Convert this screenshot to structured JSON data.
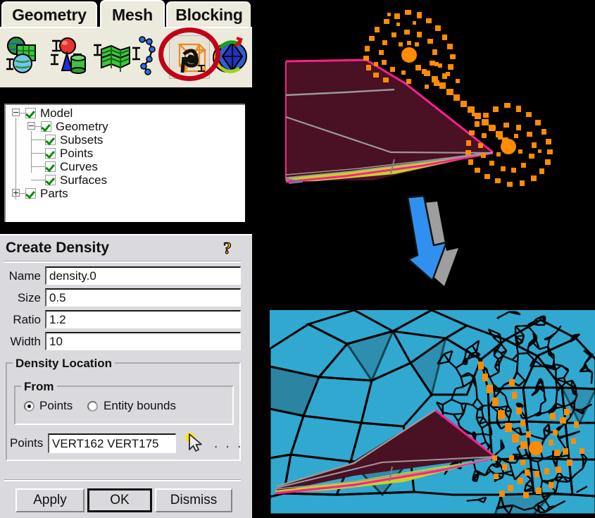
{
  "app": {
    "tabs": [
      {
        "label": "Geometry",
        "selected": false
      },
      {
        "label": "Mesh",
        "selected": true
      },
      {
        "label": "Blocking",
        "selected": false
      }
    ],
    "toolbar_icons": [
      {
        "name": "create-geometry-icon",
        "tooltip": "Create Geometry"
      },
      {
        "name": "create-body-icon",
        "tooltip": "Create Body"
      },
      {
        "name": "surface-mesh-icon",
        "tooltip": "Surface Mesh Setup"
      },
      {
        "name": "curve-mesh-icon",
        "tooltip": "Curve Mesh Setup"
      },
      {
        "name": "create-density-icon",
        "tooltip": "Create Mesh Density"
      },
      {
        "name": "compute-mesh-icon",
        "tooltip": "Compute Mesh"
      }
    ],
    "highlight_annotation": "red-circle-on-create-density-icon"
  },
  "tree": {
    "nodes": [
      {
        "label": "Model",
        "depth": 0,
        "checked": true,
        "expander": "minus"
      },
      {
        "label": "Geometry",
        "depth": 1,
        "checked": true,
        "expander": "minus"
      },
      {
        "label": "Subsets",
        "depth": 2,
        "checked": true,
        "expander": "none"
      },
      {
        "label": "Points",
        "depth": 2,
        "checked": true,
        "expander": "none"
      },
      {
        "label": "Curves",
        "depth": 2,
        "checked": true,
        "expander": "none"
      },
      {
        "label": "Surfaces",
        "depth": 2,
        "checked": true,
        "expander": "none"
      },
      {
        "label": "Parts",
        "depth": 1,
        "checked": true,
        "expander": "plus"
      }
    ]
  },
  "form": {
    "title": "Create Density",
    "help_icon": "question-mark-help-icon",
    "fields": [
      {
        "label": "Name",
        "value": "density.0"
      },
      {
        "label": "Size",
        "value": "0.5"
      },
      {
        "label": "Ratio",
        "value": "1.2"
      },
      {
        "label": "Width",
        "value": "10"
      }
    ],
    "location_group": "Density Location",
    "from_group": "From",
    "radios": [
      {
        "label": "Points",
        "selected": true
      },
      {
        "label": "Entity bounds",
        "selected": false
      }
    ],
    "points_label": "Points",
    "points_value": "VERT162 VERT175",
    "select_cursor_icon": "mouse-cursor-select-icon",
    "more_options": ". . .",
    "buttons": [
      {
        "label": "Apply",
        "default": false
      },
      {
        "label": "OK",
        "default": true
      },
      {
        "label": "Dismiss",
        "default": false
      }
    ]
  },
  "viewports": {
    "top": {
      "name": "geometry-density-preview",
      "background": "#000000",
      "surface_fill": "#4a1024",
      "surface_edge": "#ff1f8f",
      "lower_surface_fill": "#c3d12a",
      "interior_line": "#9a9a9a",
      "density_point_color": "#ff8c00",
      "density_centers": 2
    },
    "bottom": {
      "name": "generated-mesh-preview",
      "background": "#000000",
      "mesh_fill": "#31a8cf",
      "mesh_fill_dark": "#2b7e9b",
      "mesh_edge": "#000000",
      "surface_fill": "#4a1024",
      "surface_edge": "#ff1f8f",
      "lower_surface_fill": "#c3d12a",
      "density_point_color": "#ff8c00"
    },
    "arrow": {
      "name": "flow-down-arrow",
      "fill": "#2f90ef",
      "shadow": "#9e9e9e"
    }
  }
}
